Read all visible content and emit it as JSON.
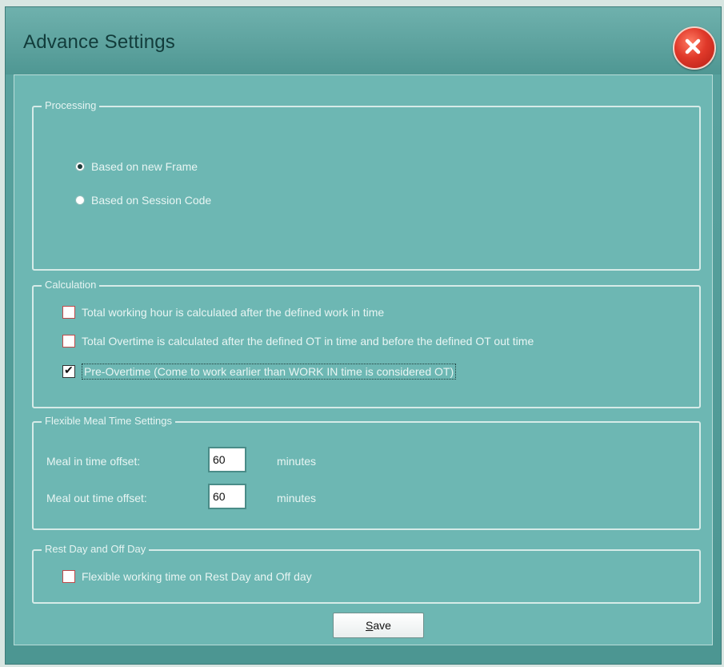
{
  "window": {
    "title": "Advance Settings"
  },
  "processing": {
    "legend": "Processing",
    "options": [
      {
        "label": "Based on new Frame",
        "checked": true
      },
      {
        "label": "Based on Session Code",
        "checked": false
      }
    ]
  },
  "calculation": {
    "legend": "Calculation",
    "options": [
      {
        "label": "Total working hour is calculated after the defined work in time",
        "checked": false
      },
      {
        "label": "Total Overtime is calculated after the defined OT in time and before the defined OT out time",
        "checked": false
      },
      {
        "label": "Pre-Overtime (Come to work earlier than WORK IN time is considered OT)",
        "checked": true
      }
    ]
  },
  "flexible_meal": {
    "legend": "Flexible Meal Time Settings",
    "meal_in": {
      "label": "Meal in time offset:",
      "value": "60",
      "unit": "minutes"
    },
    "meal_out": {
      "label": "Meal out time offset:",
      "value": "60",
      "unit": "minutes"
    }
  },
  "rest_day": {
    "legend": "Rest Day and Off Day",
    "option": {
      "label": "Flexible working time on Rest Day and Off day",
      "checked": false
    }
  },
  "buttons": {
    "save_u": "S",
    "save_rest": "ave"
  }
}
